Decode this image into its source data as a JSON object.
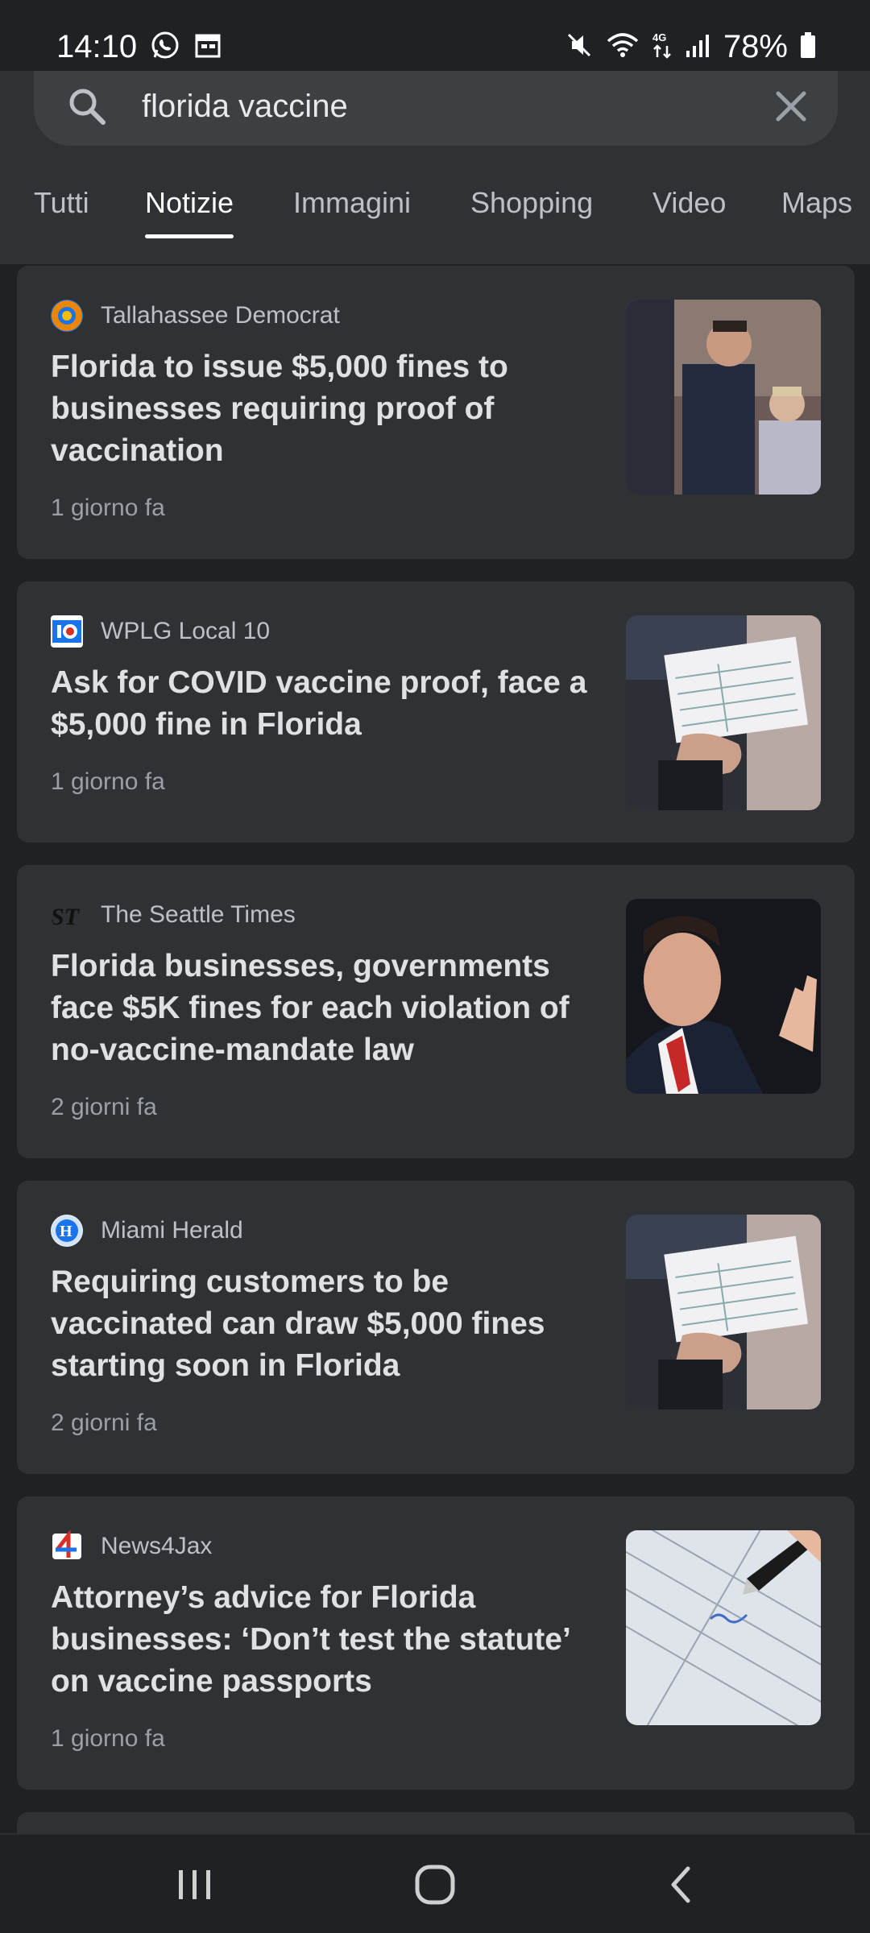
{
  "status_bar": {
    "time": "14:10",
    "battery": "78%",
    "left_icons": [
      "whatsapp-icon",
      "calendar-icon"
    ],
    "right_icons": [
      "mute-icon",
      "wifi-icon",
      "4g-icon",
      "signal-icon",
      "battery-icon"
    ]
  },
  "search": {
    "query": "florida vaccine"
  },
  "tabs": [
    {
      "label": "Tutti",
      "active": false
    },
    {
      "label": "Notizie",
      "active": true
    },
    {
      "label": "Immagini",
      "active": false
    },
    {
      "label": "Shopping",
      "active": false
    },
    {
      "label": "Video",
      "active": false
    },
    {
      "label": "Maps",
      "active": false
    }
  ],
  "articles": [
    {
      "source": "Tallahassee Democrat",
      "headline": "Florida to issue $5,000 fines to businesses requiring proof of vaccination",
      "time": "1 giorno fa",
      "image": "press-conference-photo"
    },
    {
      "source": "WPLG Local 10",
      "headline": "Ask for COVID vaccine proof, face a $5,000 fine in Florida",
      "time": "1 giorno fa",
      "image": "vaccination-card-photo"
    },
    {
      "source": "The Seattle Times",
      "headline": "Florida businesses, governments face $5K fines for each violation of no-vaccine-mandate law",
      "time": "2 giorni fa",
      "image": "governor-speaking-photo"
    },
    {
      "source": "Miami Herald",
      "headline": "Requiring customers to be vaccinated can draw $5,000 fines starting soon in Florida",
      "time": "2 giorni fa",
      "image": "vaccination-card-photo"
    },
    {
      "source": "News4Jax",
      "headline": "Attorney’s advice for Florida businesses: ‘Don’t test the statute’ on vaccine passports",
      "time": "1 giorno fa",
      "image": "form-signing-photo"
    }
  ],
  "colors": {
    "background": "#202124",
    "card": "#303134",
    "search_box": "#3c4043",
    "text_primary": "#dfe1e5",
    "text_secondary": "#9aa0a6"
  },
  "nav_bar": {
    "icons": [
      "recent-apps-icon",
      "home-icon",
      "back-icon"
    ]
  }
}
